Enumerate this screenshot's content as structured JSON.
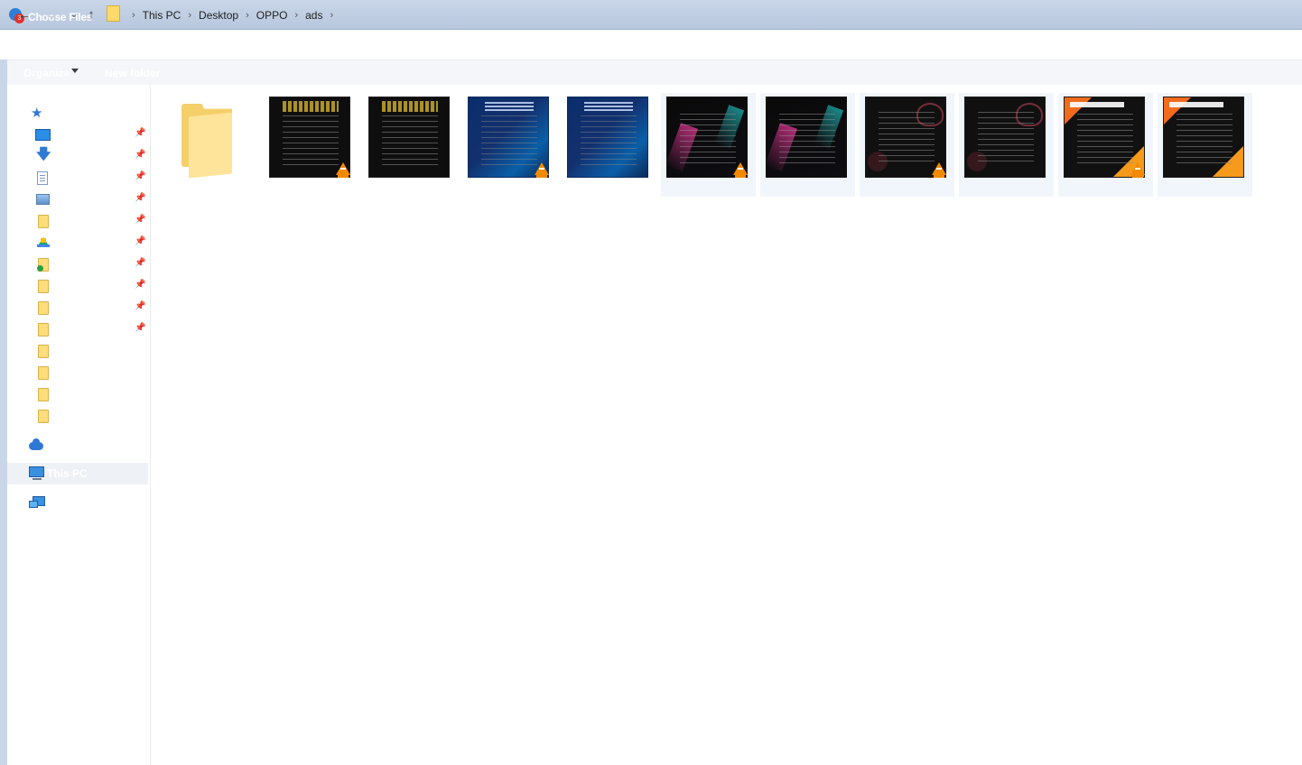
{
  "window": {
    "title": "Choose Files",
    "app_badge": "3"
  },
  "breadcrumb": [
    "This PC",
    "Desktop",
    "OPPO",
    "ads"
  ],
  "commandbar": {
    "organize_label": "Organize",
    "new_folder_label": "New folder"
  },
  "nav": {
    "this_pc_label": "This PC",
    "items": [
      {
        "icon": "star-icon",
        "pinned": false
      },
      {
        "icon": "desktop-icon",
        "pinned": true
      },
      {
        "icon": "download-icon",
        "pinned": true
      },
      {
        "icon": "documents-icon",
        "pinned": true
      },
      {
        "icon": "pictures-icon",
        "pinned": true
      },
      {
        "icon": "folder-icon",
        "pinned": true
      },
      {
        "icon": "google-drive-icon",
        "pinned": true
      },
      {
        "icon": "synced-folder-icon",
        "pinned": true
      },
      {
        "icon": "folder-icon",
        "pinned": true
      },
      {
        "icon": "folder-icon",
        "pinned": true
      },
      {
        "icon": "folder-icon",
        "pinned": true
      },
      {
        "icon": "folder-icon",
        "pinned": false
      },
      {
        "icon": "folder-icon",
        "pinned": false
      },
      {
        "icon": "folder-icon",
        "pinned": false
      },
      {
        "icon": "folder-icon",
        "pinned": false
      },
      {
        "icon": "onedrive-icon",
        "pinned": false
      },
      {
        "icon": "this-pc-icon",
        "pinned": false
      },
      {
        "icon": "network-icon",
        "pinned": false
      }
    ]
  },
  "files": [
    {
      "kind": "folder"
    },
    {
      "kind": "video",
      "style": "gold",
      "vlc": true
    },
    {
      "kind": "image",
      "style": "gold",
      "vlc": false
    },
    {
      "kind": "video",
      "style": "blue",
      "vlc": true
    },
    {
      "kind": "image",
      "style": "blue",
      "vlc": false
    },
    {
      "kind": "video",
      "style": "neon",
      "vlc": true
    },
    {
      "kind": "image",
      "style": "neon",
      "vlc": false
    },
    {
      "kind": "video",
      "style": "black",
      "vlc": true
    },
    {
      "kind": "image",
      "style": "black",
      "vlc": false
    },
    {
      "kind": "video",
      "style": "orange",
      "vlc": true
    },
    {
      "kind": "image",
      "style": "orange",
      "vlc": false
    }
  ],
  "colors": {
    "titlebar": "#c9d6e8",
    "accent": "#2f78d4",
    "folder": "#ffdd7a",
    "vlc": "#f28a00",
    "selection": "#f1f6fc"
  }
}
